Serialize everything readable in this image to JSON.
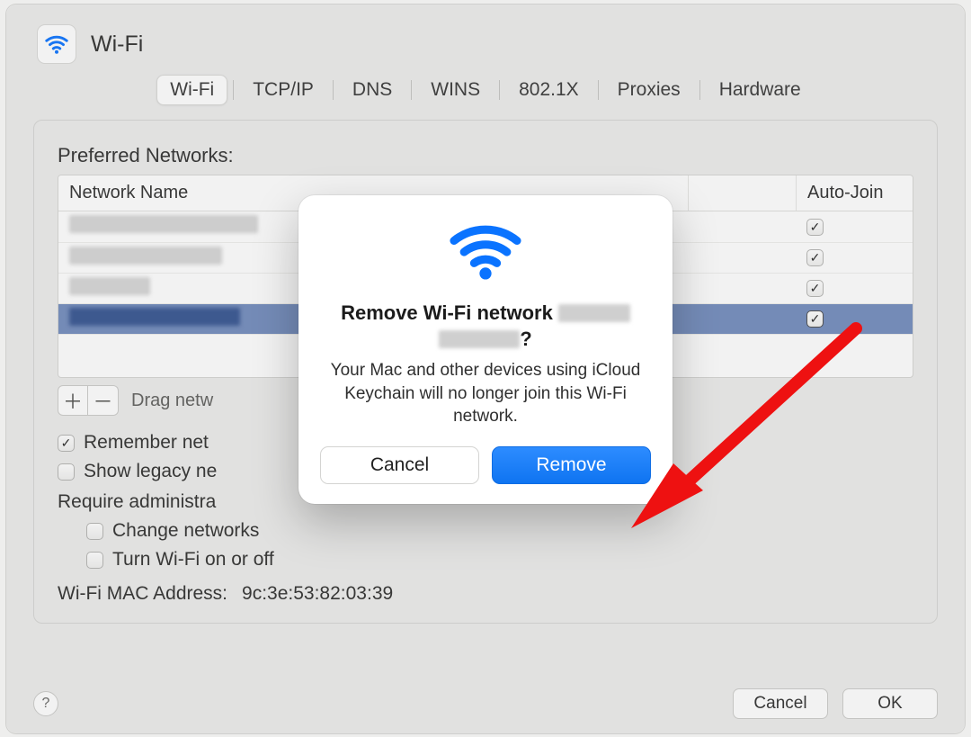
{
  "header": {
    "title": "Wi-Fi"
  },
  "tabs": [
    {
      "label": "Wi-Fi",
      "selected": true
    },
    {
      "label": "TCP/IP"
    },
    {
      "label": "DNS"
    },
    {
      "label": "WINS"
    },
    {
      "label": "802.1X"
    },
    {
      "label": "Proxies"
    },
    {
      "label": "Hardware"
    }
  ],
  "preferred_networks": {
    "section_label": "Preferred Networks:",
    "columns": {
      "name": "Network Name",
      "security": "",
      "auto_join": "Auto-Join"
    },
    "rows": [
      {
        "name_redacted": true,
        "auto_join": true,
        "selected": false
      },
      {
        "name_redacted": true,
        "auto_join": true,
        "selected": false
      },
      {
        "name_redacted": true,
        "auto_join": true,
        "selected": false
      },
      {
        "name_redacted": true,
        "auto_join": true,
        "selected": true
      }
    ],
    "drag_hint": "Drag netw"
  },
  "options": {
    "remember": {
      "label": "Remember net",
      "checked": true
    },
    "show_legacy": {
      "label": "Show legacy ne",
      "checked": false
    },
    "require_admin_label": "Require administra",
    "change_networks": {
      "label": "Change networks",
      "checked": false
    },
    "turn_wifi": {
      "label": "Turn Wi-Fi on or off",
      "checked": false
    }
  },
  "mac_address": {
    "label": "Wi-Fi MAC Address:",
    "value": "9c:3e:53:82:03:39"
  },
  "footer": {
    "help": "?",
    "cancel": "Cancel",
    "ok": "OK"
  },
  "modal": {
    "title_prefix": "Remove Wi-Fi network ",
    "title_suffix": "?",
    "description": "Your Mac and other devices using iCloud Keychain will no longer join this Wi-Fi network.",
    "cancel": "Cancel",
    "confirm": "Remove"
  }
}
